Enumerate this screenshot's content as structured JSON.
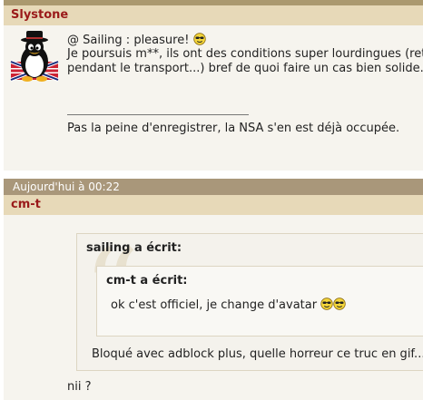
{
  "post1": {
    "author": "Slystone",
    "lines": [
      "@ Sailing : pleasure!",
      "Je poursuis m**, ils ont des conditions super lourdingues (ret",
      "pendant le transport...) bref de quoi faire un cas bien solide. T"
    ],
    "signature": "Pas la peine d'enregistrer, la NSA s'en est déjà occupée."
  },
  "post2": {
    "date": "Aujourd'hui à 00:22",
    "author": "cm-t",
    "outer_quote": {
      "title": "sailing a écrit:",
      "text": "Bloqué avec adblock plus, quelle horreur ce truc en gif..."
    },
    "inner_quote": {
      "title": "cm-t a écrit:",
      "text": "ok c'est officiel, je change d'avatar"
    },
    "reply": "nii ?"
  },
  "colors": {
    "author_bar": "#e7d9b8",
    "author_name": "#9a1a1a",
    "date_bar": "#a9977a",
    "post_bg": "#f6f4ee"
  }
}
